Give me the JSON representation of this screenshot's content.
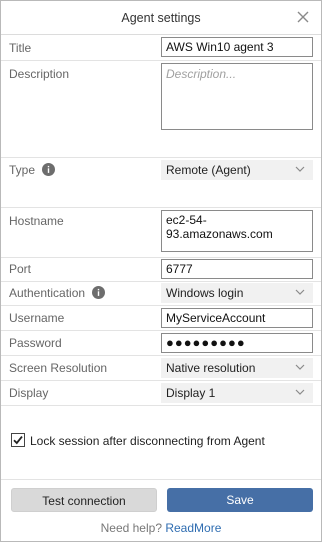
{
  "dialog": {
    "title": "Agent settings"
  },
  "fields": {
    "title": {
      "label": "Title",
      "value": "AWS Win10 agent 3"
    },
    "description": {
      "label": "Description",
      "placeholder": "Description..."
    },
    "type": {
      "label": "Type",
      "value": "Remote (Agent)"
    },
    "hostname": {
      "label": "Hostname",
      "value": "ec2-54-93.amazonaws.com"
    },
    "port": {
      "label": "Port",
      "value": "6777"
    },
    "authentication": {
      "label": "Authentication",
      "value": "Windows login"
    },
    "username": {
      "label": "Username",
      "value": "MyServiceAccount"
    },
    "password": {
      "label": "Password",
      "value": "●●●●●●●●●"
    },
    "screen_resolution": {
      "label": "Screen Resolution",
      "value": "Native resolution"
    },
    "display": {
      "label": "Display",
      "value": "Display 1"
    }
  },
  "options": {
    "lock_session": {
      "label": "Lock session after disconnecting from Agent",
      "checked": true
    }
  },
  "buttons": {
    "test": "Test connection",
    "save": "Save"
  },
  "help": {
    "text": "Need help?",
    "link": "ReadMore"
  },
  "colors": {
    "primary": "#466fa6",
    "secondary_button": "#d9d9d9",
    "link": "#2f6db1",
    "select_bg": "#f1f1f1"
  },
  "icons": {
    "close": "close-icon",
    "info": "info-icon",
    "chevron": "chevron-down-icon",
    "check": "checkmark-icon"
  }
}
